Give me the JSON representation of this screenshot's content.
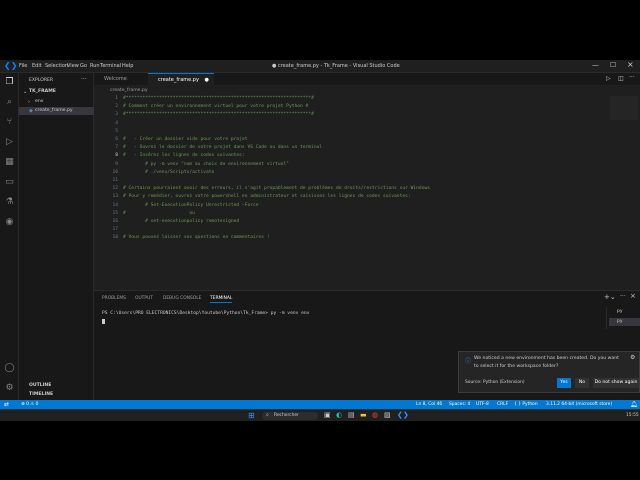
{
  "window": {
    "title": "● create_frame.py - Tk_Frame - Visual Studio Code",
    "menus": [
      "File",
      "Edit",
      "Selection",
      "View",
      "Go",
      "Run",
      "Terminal",
      "Help"
    ]
  },
  "sidebar": {
    "header": "EXPLORER",
    "root": "TK_FRAME",
    "items": [
      "env",
      "create_frame.py"
    ],
    "outline": "OUTLINE",
    "timeline": "TIMELINE"
  },
  "tabs": [
    {
      "label": "Welcome",
      "active": false
    },
    {
      "label": "create_frame.py",
      "active": true
    }
  ],
  "breadcrumb": "create_frame.py",
  "code": {
    "lines": [
      {
        "n": "1",
        "text": "#*******************************************************************#"
      },
      {
        "n": "2",
        "text": "# Comment créer un environnement virtuel pour votre projet Python #"
      },
      {
        "n": "3",
        "text": "#*******************************************************************#"
      },
      {
        "n": "4",
        "text": ""
      },
      {
        "n": "5",
        "text": ""
      },
      {
        "n": "6",
        "text": "#   - Créer un dossier vide pour votre projet"
      },
      {
        "n": "7",
        "text": "#   - Ouvrez le dossier de votre projet dans VS Code ou dans un terminal"
      },
      {
        "n": "8",
        "text": "#   - Insérez les lignes de codes suivantes:"
      },
      {
        "n": "9",
        "text": "        # py -m venv \"nom au choix de environnement virtuel\""
      },
      {
        "n": "10",
        "text": "        # ./venv/Scripts/activate"
      },
      {
        "n": "11",
        "text": ""
      },
      {
        "n": "12",
        "text": "# Certains pourraient avoir des erreurs, il s'agit propablement de problèmes de droits/restrictions sur Windows"
      },
      {
        "n": "13",
        "text": "# Pour y remédier, ouvrez votre powershell en administrateur et saisissez les lignes de codes suivantes:"
      },
      {
        "n": "14",
        "text": "        # Set-ExecutionPolicy Unrestricted -Force"
      },
      {
        "n": "15",
        "text": "#                       ou"
      },
      {
        "n": "16",
        "text": "        # set-executionpolicy remotesigned"
      },
      {
        "n": "17",
        "text": ""
      },
      {
        "n": "18",
        "text": "# Vous pouvez laisser vos questions en commentaires !"
      }
    ]
  },
  "panel": {
    "tabs": [
      "PROBLEMS",
      "OUTPUT",
      "DEBUG CONSOLE",
      "TERMINAL"
    ],
    "terminal_line": "PS C:\\Users\\PRO ELECTRONICS\\Desktop\\Youtube\\Python\\Tk_Frame> py -m venv env",
    "shells": [
      "py",
      "py"
    ]
  },
  "notification": {
    "message": "We noticed a new environment has been created. Do you want to select it for the workspace folder?",
    "source": "Source: Python (Extension)",
    "yes": "Yes",
    "no": "No",
    "dont_show": "Do not show again"
  },
  "statusbar": {
    "errors": "⊗ 0 ⚠ 0",
    "position": "Ln 8, Col 46",
    "spaces": "Spaces: 4",
    "encoding": "UTF-8",
    "eol": "CRLF",
    "language": "{ } Python",
    "interpreter": "3.11.2 64-bit (microsoft store)"
  },
  "taskbar": {
    "search": "Rechercher",
    "time": "15:55"
  }
}
